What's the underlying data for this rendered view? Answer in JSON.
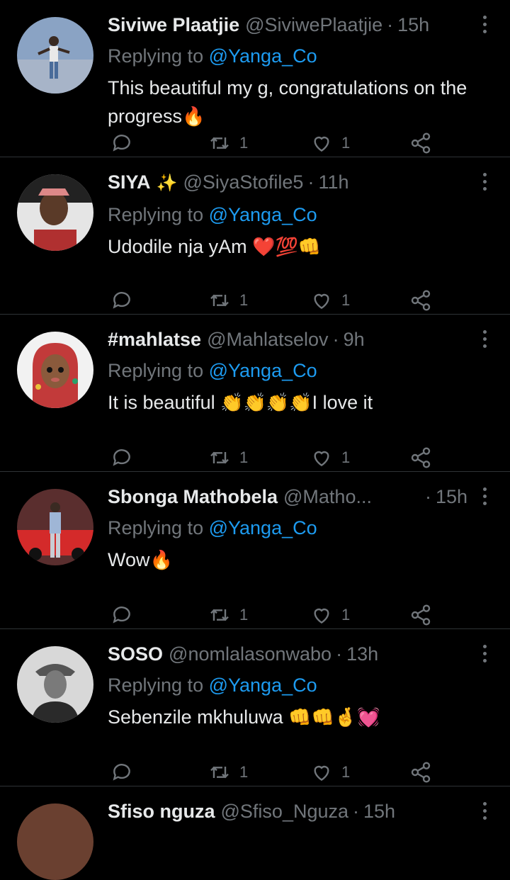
{
  "tweets": [
    {
      "name": "Siviwe Plaatjie",
      "badge": "",
      "handle": "@SiviwePlaatjie",
      "time": "15h",
      "replying_label": "Replying to",
      "replying_to": "@Yanga_Co",
      "text": "This beautiful my g, congratulations on the progress",
      "emojis": "🔥",
      "retweets": "1",
      "likes": "1"
    },
    {
      "name": "SIYA",
      "badge": "✨",
      "handle": "@SiyaStofile5",
      "time": "11h",
      "replying_label": "Replying to",
      "replying_to": "@Yanga_Co",
      "text": "Udodile nja yAm",
      "emojis": "❤️💯👊",
      "retweets": "1",
      "likes": "1"
    },
    {
      "name": "#mahlatse",
      "badge": "",
      "handle": "@Mahlatselov",
      "time": "9h",
      "replying_label": "Replying to",
      "replying_to": "@Yanga_Co",
      "text": "It is beautiful",
      "emojis": "👏👏👏👏",
      "text_after": "I love it",
      "retweets": "1",
      "likes": "1"
    },
    {
      "name": "Sbonga Mathobela",
      "badge": "",
      "handle": "@Matho...",
      "time": "15h",
      "replying_label": "Replying to",
      "replying_to": "@Yanga_Co",
      "text": "Wow",
      "emojis": "🔥",
      "retweets": "1",
      "likes": "1"
    },
    {
      "name": "SOSO",
      "badge": "",
      "handle": "@nomlalasonwabo",
      "time": "13h",
      "replying_label": "Replying to",
      "replying_to": "@Yanga_Co",
      "text": "Sebenzile mkhuluwa",
      "emojis": "👊👊🤞💓",
      "retweets": "1",
      "likes": "1"
    }
  ],
  "partial": {
    "name": "Sfiso nguza",
    "handle": "@Sfiso_Nguza",
    "time": "15h"
  },
  "colors": {
    "background": "#000000",
    "text": "#e7e9ea",
    "muted": "#71767b",
    "accent": "#1d9bf0",
    "divider": "#2f3336"
  }
}
